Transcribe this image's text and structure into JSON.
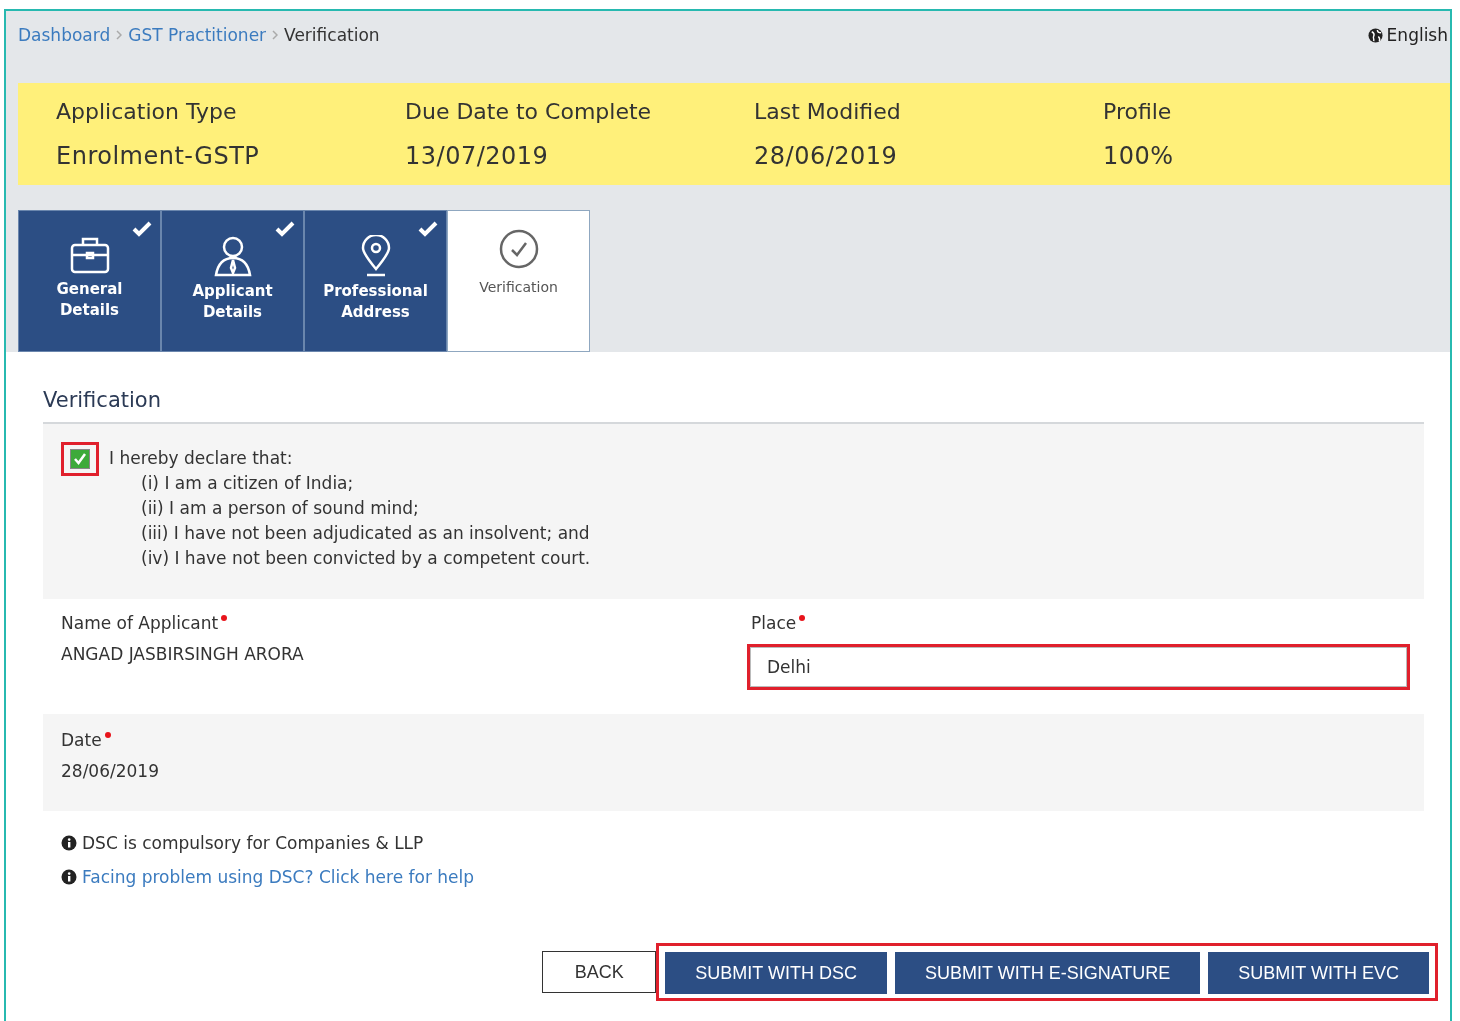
{
  "breadcrumb": [
    {
      "label": "Dashboard",
      "link": true
    },
    {
      "label": "GST Practitioner",
      "link": true
    },
    {
      "label": "Verification",
      "link": false
    }
  ],
  "language": "English",
  "summary": [
    {
      "label": "Application Type",
      "value": "Enrolment-GSTP"
    },
    {
      "label": "Due Date to Complete",
      "value": "13/07/2019"
    },
    {
      "label": "Last Modified",
      "value": "28/06/2019"
    },
    {
      "label": "Profile",
      "value": "100%"
    }
  ],
  "tabs": [
    {
      "label": "General Details",
      "kind": "briefcase",
      "completed": true,
      "selected": false
    },
    {
      "label": "Applicant Details",
      "kind": "person",
      "completed": true,
      "selected": false
    },
    {
      "label": "Professional Address",
      "kind": "pin",
      "completed": true,
      "selected": false
    },
    {
      "label": "Verification",
      "kind": "check",
      "completed": false,
      "selected": true
    }
  ],
  "section_title": "Verification",
  "declaration": {
    "checked": true,
    "highlighted": true,
    "heading": "I hereby declare that:",
    "points": [
      "(i) I am a citizen of India;",
      "(ii) I am a person of sound mind;",
      "(iii) I have not been adjudicated as an insolvent; and",
      "(iv) I have not been convicted by a competent court."
    ]
  },
  "name_of_applicant": {
    "label": "Name of Applicant",
    "required": true,
    "value": "ANGAD JASBIRSINGH ARORA"
  },
  "place": {
    "label": "Place",
    "required": true,
    "value": "Delhi",
    "highlighted": true
  },
  "date": {
    "label": "Date",
    "required": true,
    "value": "28/06/2019"
  },
  "notes": [
    {
      "text": "DSC is compulsory for Companies & LLP",
      "link": false
    },
    {
      "text": "Facing problem using DSC? Click here for help",
      "link": true
    }
  ],
  "back_button": "BACK",
  "submit_buttons": [
    "SUBMIT WITH DSC",
    "SUBMIT WITH E-SIGNATURE",
    "SUBMIT WITH EVC"
  ],
  "submit_buttons_highlighted": true
}
